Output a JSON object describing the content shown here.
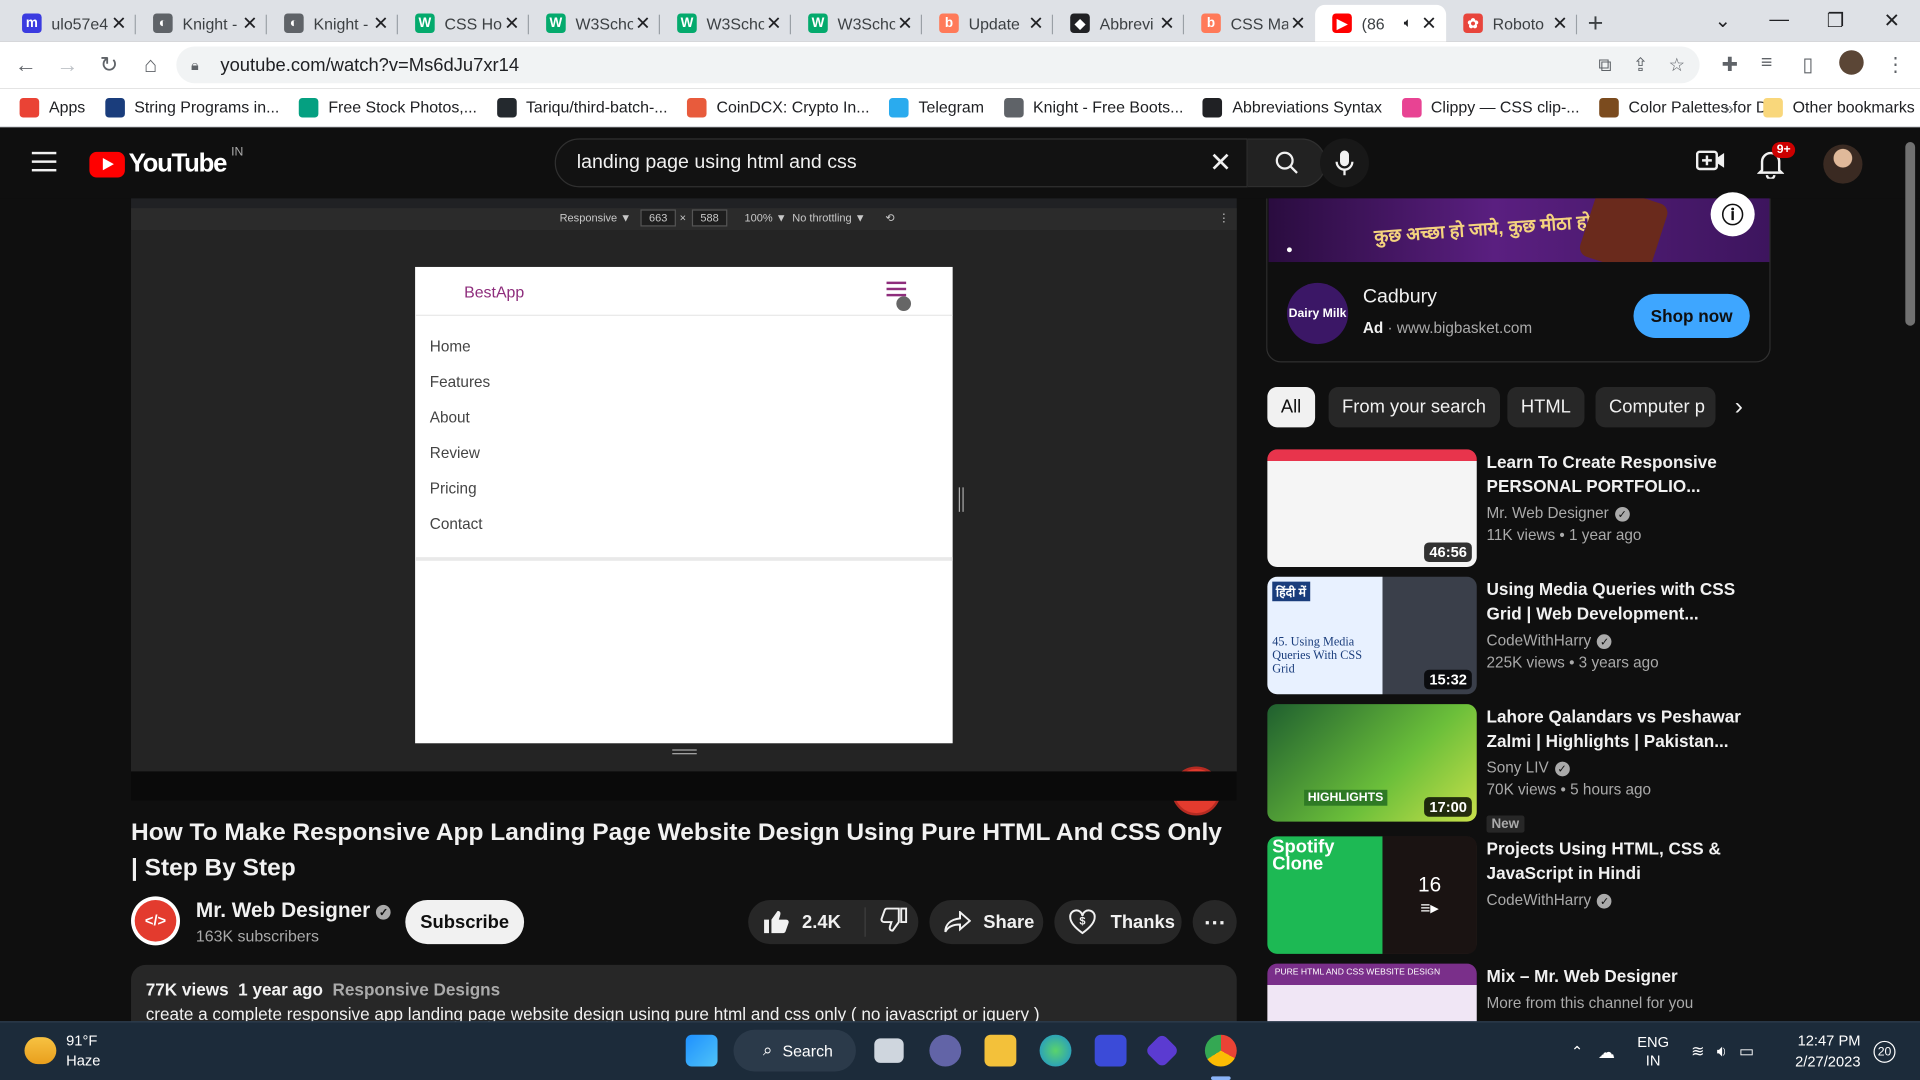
{
  "browser": {
    "tabs": [
      {
        "title": "ulo57e4",
        "color": "#3b3be0",
        "glyph": "m"
      },
      {
        "title": "Knight -",
        "color": "#5f6368",
        "glyph": "◐"
      },
      {
        "title": "Knight -",
        "color": "#5f6368",
        "glyph": "◐"
      },
      {
        "title": "CSS Ho",
        "color": "#04aa6d",
        "glyph": "W"
      },
      {
        "title": "W3Scho",
        "color": "#04aa6d",
        "glyph": "W"
      },
      {
        "title": "W3Scho",
        "color": "#04aa6d",
        "glyph": "W"
      },
      {
        "title": "W3Scho",
        "color": "#04aa6d",
        "glyph": "W"
      },
      {
        "title": "Update",
        "color": "#ff7a59",
        "glyph": "b"
      },
      {
        "title": "Abbrevi",
        "color": "#202124",
        "glyph": "◆"
      },
      {
        "title": "CSS Ma",
        "color": "#ff7a59",
        "glyph": "b"
      },
      {
        "title": "(86",
        "color": "#ff0000",
        "glyph": "▶"
      },
      {
        "title": "Roboto",
        "color": "#e8453c",
        "glyph": "✿"
      }
    ],
    "url": "youtube.com/watch?v=Ms6dJu7xr14",
    "bookmarks": [
      {
        "label": "Apps",
        "color": "#ea4335"
      },
      {
        "label": "String Programs in...",
        "color": "#1a3d7c"
      },
      {
        "label": "Free Stock Photos,...",
        "color": "#05a081"
      },
      {
        "label": "Tariqu/third-batch-...",
        "color": "#24292e"
      },
      {
        "label": "CoinDCX: Crypto In...",
        "color": "#e85b3c"
      },
      {
        "label": "Telegram",
        "color": "#2aabee"
      },
      {
        "label": "Knight - Free Boots...",
        "color": "#5f6368"
      },
      {
        "label": "Abbreviations Syntax",
        "color": "#202124"
      },
      {
        "label": "Clippy — CSS clip-...",
        "color": "#e84393"
      },
      {
        "label": "Color Palettes for D...",
        "color": "#7b4b1e"
      }
    ],
    "other_bookmarks": "Other bookmarks",
    "overflow": "»"
  },
  "youtube": {
    "logo_text": "YouTube",
    "country_code": "IN",
    "search_query": "landing page using html and css",
    "notification_count": "9+",
    "player": {
      "devtools": {
        "mode": "Responsive ▼",
        "width": "663",
        "height": "588",
        "zoom": "100% ▼",
        "throttle": "No throttling ▼"
      },
      "brand": "BestApp",
      "menu": [
        "Home",
        "Features",
        "About",
        "Review",
        "Pricing",
        "Contact"
      ],
      "watermark": "</>"
    },
    "video_title": "How To Make Responsive App Landing Page Website Design Using Pure HTML And CSS Only | Step By Step",
    "channel": {
      "name": "Mr. Web Designer",
      "subscribers": "163K subscribers",
      "avatar_text": "</>"
    },
    "subscribe_label": "Subscribe",
    "likes": "2.4K",
    "share_label": "Share",
    "thanks_label": "Thanks",
    "description": {
      "views": "77K views",
      "age": "1 year ago",
      "tag": "Responsive Designs",
      "text": "create a complete responsive app landing page website design using pure html and css only ( no javascript or jquery )"
    },
    "ad": {
      "banner_text": "कुछ अच्छा हो जाये, कुछ मीठा हो जाये.",
      "logo_text": "Dairy Milk",
      "advertiser": "Cadbury",
      "ad_label": "Ad",
      "domain": "www.bigbasket.com",
      "cta": "Shop now"
    },
    "chips": [
      "All",
      "From your search",
      "HTML",
      "Computer p"
    ],
    "recommendations": [
      {
        "title": "Learn To Create Responsive PERSONAL PORTFOLIO...",
        "channel": "Mr. Web Designer",
        "meta": "11K views • 1 year ago",
        "duration": "46:56",
        "verified": true,
        "thumb": "portfolio"
      },
      {
        "title": "Using Media Queries with CSS Grid | Web Development...",
        "channel": "CodeWithHarry",
        "meta": "225K views • 3 years ago",
        "duration": "15:32",
        "verified": true,
        "thumb": "media",
        "thumb_text": "45. Using Media Queries With CSS Grid",
        "thumb_badge": "हिंदी में"
      },
      {
        "title": "Lahore Qalandars vs Peshawar Zalmi | Highlights | Pakistan...",
        "channel": "Sony LIV",
        "meta": "70K views • 5 hours ago",
        "duration": "17:00",
        "verified": true,
        "badge": "New",
        "thumb": "cricket",
        "thumb_text": "HIGHLIGHTS"
      },
      {
        "title": "Projects Using HTML, CSS & JavaScript in Hindi",
        "channel": "CodeWithHarry",
        "meta": "",
        "duration": "",
        "playlist_count": "16",
        "verified": true,
        "thumb": "spotify",
        "thumb_text": "Spotify Clone"
      },
      {
        "title": "Mix – Mr. Web Designer",
        "channel": "More from this channel for you",
        "meta": "",
        "duration": "",
        "verified": false,
        "thumb": "mix",
        "thumb_text": "PURE HTML AND CSS WEBSITE DESIGN"
      }
    ]
  },
  "taskbar": {
    "weather_temp": "91°F",
    "weather_desc": "Haze",
    "search_label": "Search",
    "lang": "ENG",
    "region": "IN",
    "time": "12:47 PM",
    "date": "2/27/2023",
    "notifications": "20"
  }
}
